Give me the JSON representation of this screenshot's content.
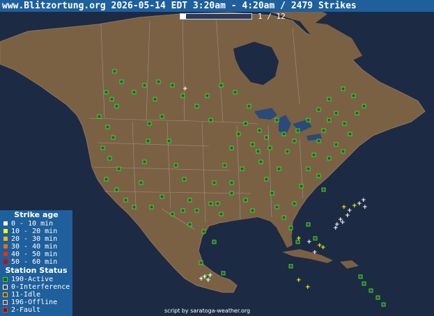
{
  "header": {
    "title": "www.Blitzortung.org 2026-05-14 EDT 3:20am - 4:20am / 2479 Strikes"
  },
  "animation": {
    "page_indicator": "1 / 12",
    "frame_current": 1,
    "frame_total": 12
  },
  "legend": {
    "strike_title": "Strike age",
    "strike_items": [
      {
        "label": "0 - 10 min",
        "color": "#ffffff"
      },
      {
        "label": "10 - 20 min",
        "color": "#ffff00"
      },
      {
        "label": "20 - 30 min",
        "color": "#ffb400"
      },
      {
        "label": "30 - 40 min",
        "color": "#ff6a00"
      },
      {
        "label": "40 - 50 min",
        "color": "#ff2a00"
      },
      {
        "label": "50 - 60 min",
        "color": "#d80000"
      }
    ],
    "station_title": "Station Status",
    "station_items": [
      {
        "label": "190-Active",
        "color": "#3fd23f",
        "fill": "#2b5a22"
      },
      {
        "label": "0-Interference",
        "color": "#ffffff",
        "fill": "#444444"
      },
      {
        "label": "11-Idle",
        "color": "#f0c040",
        "fill": "#5a4a22"
      },
      {
        "label": "196-Offline",
        "color": "#d8d8d8",
        "fill": "#555555"
      },
      {
        "label": "2-Fault",
        "color": "#ff3030",
        "fill": "#5a2222"
      }
    ]
  },
  "credit": "script by saratoga-weather.org",
  "colors": {
    "ocean": "#1c2a44",
    "land": "#7a6144",
    "header_bg": "#1e5f9c",
    "boundary": "#b0aaa0"
  }
}
